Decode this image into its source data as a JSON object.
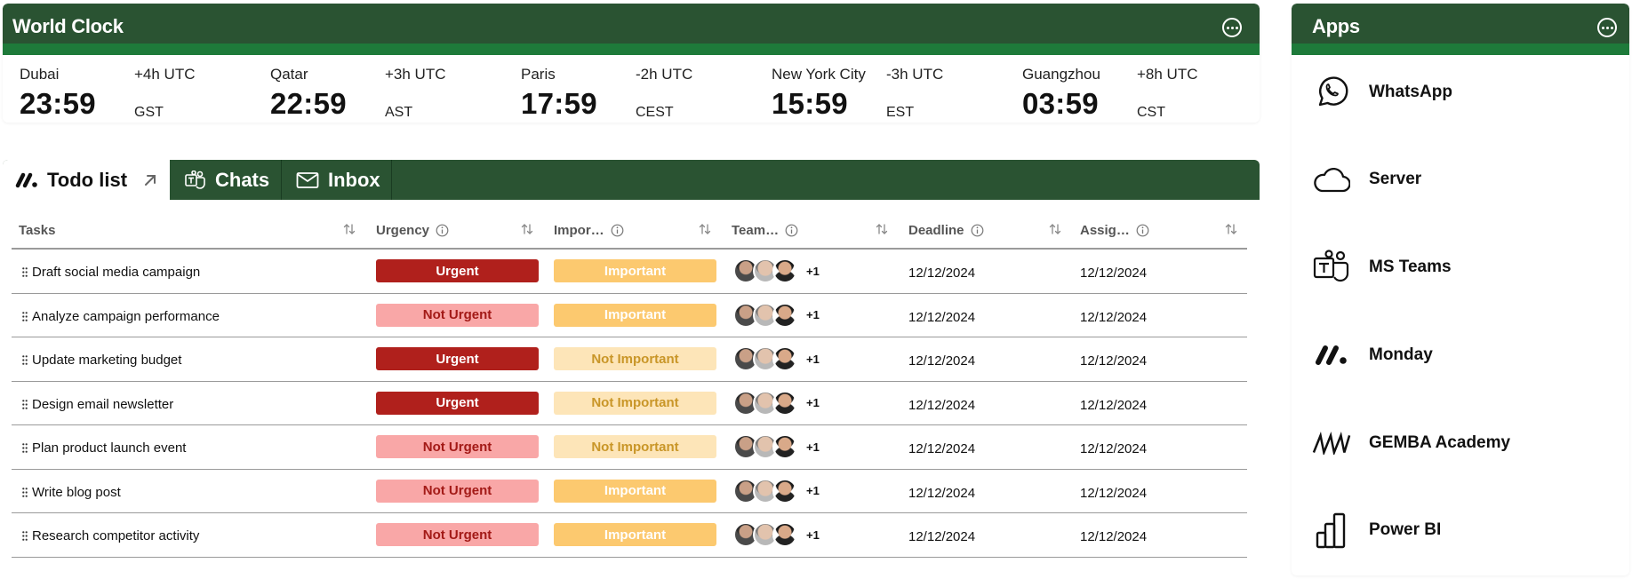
{
  "world_clock": {
    "title": "World Clock",
    "clocks": [
      {
        "city": "Dubai",
        "offset": "+4h UTC",
        "time": "23:59",
        "tz": "GST"
      },
      {
        "city": "Qatar",
        "offset": "+3h UTC",
        "time": "22:59",
        "tz": "AST"
      },
      {
        "city": "Paris",
        "offset": "-2h UTC",
        "time": "17:59",
        "tz": "CEST"
      },
      {
        "city": "New York City",
        "offset": "-3h UTC",
        "time": "15:59",
        "tz": "EST"
      },
      {
        "city": "Guangzhou",
        "offset": "+8h UTC",
        "time": "03:59",
        "tz": "CST"
      }
    ]
  },
  "tabs": [
    {
      "label": "Todo list",
      "icon": "monday-icon",
      "active": true
    },
    {
      "label": "Chats",
      "icon": "teams-icon",
      "active": false
    },
    {
      "label": "Inbox",
      "icon": "mail-icon",
      "active": false
    }
  ],
  "table": {
    "columns": [
      {
        "label": "Tasks"
      },
      {
        "label": "Urgency"
      },
      {
        "label": "Impor…"
      },
      {
        "label": "Team…"
      },
      {
        "label": "Deadline"
      },
      {
        "label": "Assig…"
      }
    ],
    "rows": [
      {
        "task": "Draft social media campaign",
        "urgency": "Urgent",
        "importance": "Important",
        "extra": "+1",
        "deadline": "12/12/2024",
        "assigned": "12/12/2024"
      },
      {
        "task": "Analyze campaign performance",
        "urgency": "Not Urgent",
        "importance": "Important",
        "extra": "+1",
        "deadline": "12/12/2024",
        "assigned": "12/12/2024"
      },
      {
        "task": "Update marketing budget",
        "urgency": "Urgent",
        "importance": "Not Important",
        "extra": "+1",
        "deadline": "12/12/2024",
        "assigned": "12/12/2024"
      },
      {
        "task": "Design email newsletter",
        "urgency": "Urgent",
        "importance": "Not Important",
        "extra": "+1",
        "deadline": "12/12/2024",
        "assigned": "12/12/2024"
      },
      {
        "task": "Plan product launch event",
        "urgency": "Not Urgent",
        "importance": "Not Important",
        "extra": "+1",
        "deadline": "12/12/2024",
        "assigned": "12/12/2024"
      },
      {
        "task": "Write blog post",
        "urgency": "Not Urgent",
        "importance": "Important",
        "extra": "+1",
        "deadline": "12/12/2024",
        "assigned": "12/12/2024"
      },
      {
        "task": "Research competitor activity",
        "urgency": "Not Urgent",
        "importance": "Important",
        "extra": "+1",
        "deadline": "12/12/2024",
        "assigned": "12/12/2024"
      }
    ]
  },
  "apps": {
    "title": "Apps",
    "items": [
      {
        "label": "WhatsApp",
        "icon": "whatsapp-icon"
      },
      {
        "label": "Server",
        "icon": "cloud-icon"
      },
      {
        "label": "MS Teams",
        "icon": "teams-icon"
      },
      {
        "label": "Monday",
        "icon": "monday-icon"
      },
      {
        "label": "GEMBA Academy",
        "icon": "gemba-icon"
      },
      {
        "label": "Power BI",
        "icon": "powerbi-icon"
      }
    ]
  },
  "colors": {
    "header_green": "#2a5332",
    "header_stripe": "#1e7a3a",
    "urgent_bg": "#b0201c",
    "urgent_text": "#ffffff",
    "not_urgent_bg": "#f9a7a7",
    "not_urgent_text": "#a31a17",
    "important_bg": "#fcc96f",
    "important_text": "#ffffff",
    "not_important_bg": "#fde5b8",
    "not_important_text": "#c99628"
  }
}
